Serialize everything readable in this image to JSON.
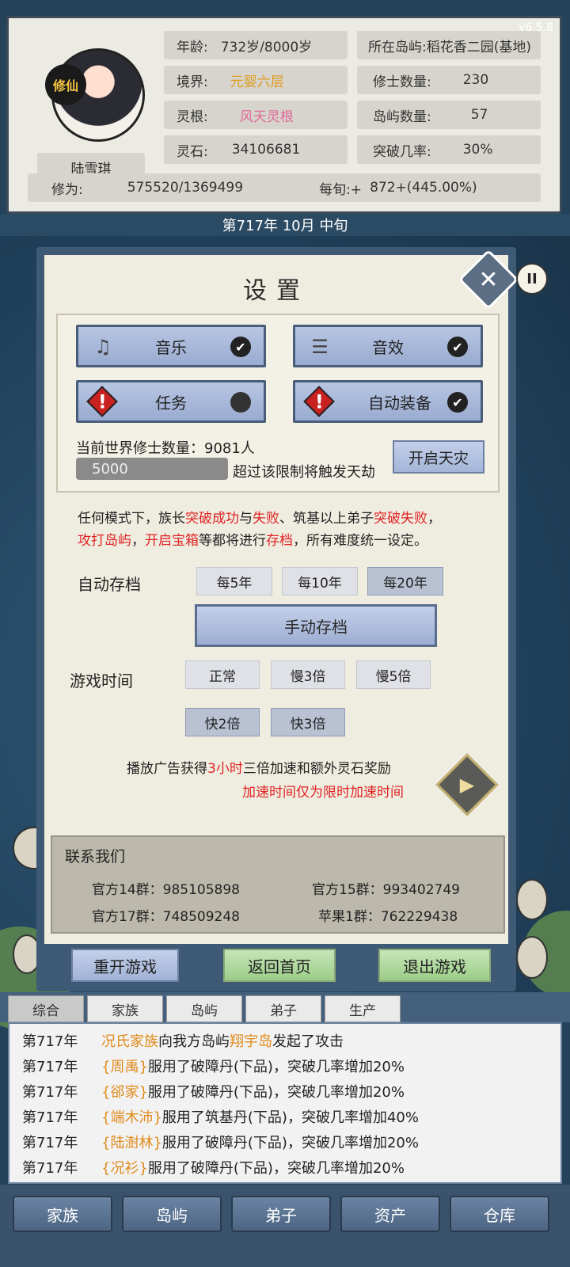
{
  "version": "v6.5.8",
  "profile": {
    "badge": "修仙",
    "name": "陆雪琪",
    "age_label": "年龄:",
    "age_value": "732岁/8000岁",
    "realm_label": "境界:",
    "realm_value": "元婴六层",
    "root_label": "灵根:",
    "root_value": "风天灵根",
    "stone_label": "灵石:",
    "stone_value": "34106681",
    "island_location": "所在岛屿:",
    "island_name": "稻花香二园(基地)",
    "cultivator_label": "修士数量:",
    "cultivator_value": "230",
    "islands_label": "岛屿数量:",
    "islands_value": "57",
    "breakthrough_label": "突破几率:",
    "breakthrough_value": "30%",
    "cultivation_label": "修为:",
    "cultivation_value": "575520/1369499",
    "per_period_label": "每旬:+",
    "per_period_value": "872+(445.00%)"
  },
  "date": "第717年 10月 中旬",
  "settings": {
    "title": "设置",
    "close_icon": "close-icon",
    "toggles": {
      "music": "音乐",
      "sfx": "音效",
      "quest": "任务",
      "auto_equip": "自动装备"
    },
    "world_count_label": "当前世界修士数量：",
    "world_count_value": "9081人",
    "limit_value": "5000",
    "limit_hint": "超过该限制将触发天劫",
    "disaster_button": "开启天灾",
    "rule_parts": {
      "p1": "任何模式下，族长",
      "p2": "突破成功",
      "p3": "与",
      "p4": "失败",
      "p5": "、筑基以上弟子",
      "p6": "突破失败",
      "p7": "，",
      "p8": "攻打岛屿",
      "p9": "，",
      "p10": "开启宝箱",
      "p11": "等都将进行",
      "p12": "存档",
      "p13": "，所有难度统一设定。"
    },
    "autosave_label": "自动存档",
    "autosave_options": [
      "每5年",
      "每10年",
      "每20年"
    ],
    "manual_save": "手动存档",
    "game_time_label": "游戏时间",
    "time_options": [
      "正常",
      "慢3倍",
      "慢5倍",
      "快2倍",
      "快3倍"
    ],
    "ad_parts": {
      "a1": "播放广告获得",
      "a2": "3小时",
      "a3": "三倍加速和额外灵石奖励",
      "a4": "加速时间仅为限时加速时间"
    },
    "contact_title": "联系我们",
    "contacts": [
      {
        "label": "官方14群：",
        "value": "985105898"
      },
      {
        "label": "官方15群：",
        "value": "993402749"
      },
      {
        "label": "官方17群：",
        "value": "748509248"
      },
      {
        "label": "苹果1群：",
        "value": "762229438"
      }
    ],
    "restart": "重开游戏",
    "home": "返回首页",
    "exit": "退出游戏"
  },
  "tabs": [
    "综合",
    "家族",
    "岛屿",
    "弟子",
    "生产"
  ],
  "log": [
    {
      "year": "第717年",
      "subject": "况氏家族",
      "mid": "向我方岛屿",
      "target": "翔宇岛",
      "rest": "发起了攻击"
    },
    {
      "year": "第717年",
      "subject": "{周禹}",
      "rest": "服用了破障丹(下品)，突破几率增加20%"
    },
    {
      "year": "第717年",
      "subject": "{郤家}",
      "rest": "服用了破障丹(下品)，突破几率增加20%"
    },
    {
      "year": "第717年",
      "subject": "{端木沛}",
      "rest": "服用了筑基丹(下品)，突破几率增加40%"
    },
    {
      "year": "第717年",
      "subject": "{陆澍林}",
      "rest": "服用了破障丹(下品)，突破几率增加20%"
    },
    {
      "year": "第717年",
      "subject": "{况衫}",
      "rest": "服用了破障丹(下品)，突破几率增加20%"
    }
  ],
  "nav": [
    "家族",
    "岛屿",
    "弟子",
    "资产",
    "仓库"
  ],
  "colors": {
    "accent_red": "#e02424",
    "accent_orange": "#e09a1e",
    "realm_pink": "#e06a9a"
  }
}
